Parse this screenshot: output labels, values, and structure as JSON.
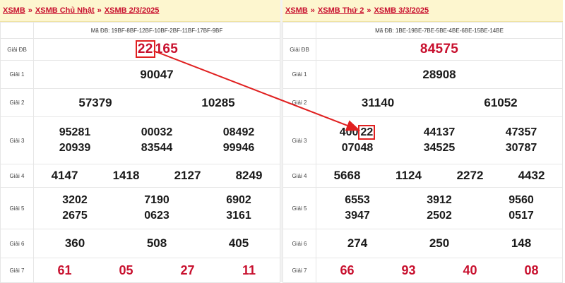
{
  "left": {
    "breadcrumb": [
      "XSMB",
      "XSMB Chủ Nhật",
      "XSMB 2/3/2025"
    ],
    "ma_db": "Mã ĐB: 19BF-8BF-12BF-10BF-2BF-11BF-17BF-9BF",
    "labels": {
      "db": "Giải ĐB",
      "g1": "Giải 1",
      "g2": "Giải 2",
      "g3": "Giải 3",
      "g4": "Giải 4",
      "g5": "Giải 5",
      "g6": "Giải 6",
      "g7": "Giải 7"
    },
    "special_highlight": "22",
    "special_rest": "165",
    "g1": "90047",
    "g2": [
      "57379",
      "10285"
    ],
    "g3": [
      "95281",
      "00032",
      "08492",
      "20939",
      "83544",
      "99946"
    ],
    "g4": [
      "4147",
      "1418",
      "2127",
      "8249"
    ],
    "g5": [
      "3202",
      "7190",
      "6902",
      "2675",
      "0623",
      "3161"
    ],
    "g6": [
      "360",
      "508",
      "405"
    ],
    "g7": [
      "61",
      "05",
      "27",
      "11"
    ]
  },
  "right": {
    "breadcrumb": [
      "XSMB",
      "XSMB Thứ 2",
      "XSMB 3/3/2025"
    ],
    "ma_db": "Mã ĐB: 1BE-19BE-7BE-5BE-4BE-6BE-15BE-14BE",
    "labels": {
      "db": "Giải ĐB",
      "g1": "Giải 1",
      "g2": "Giải 2",
      "g3": "Giải 3",
      "g4": "Giải 4",
      "g5": "Giải 5",
      "g6": "Giải 6",
      "g7": "Giải 7"
    },
    "special": "84575",
    "g1": "28908",
    "g2": [
      "31140",
      "61052"
    ],
    "g3_first_prefix": "400",
    "g3_first_highlight": "22",
    "g3": [
      "44137",
      "47357",
      "07048",
      "34525",
      "30787"
    ],
    "g4": [
      "5668",
      "1124",
      "2272",
      "4432"
    ],
    "g5": [
      "6553",
      "3912",
      "9560",
      "3947",
      "2502",
      "0517"
    ],
    "g6": [
      "274",
      "250",
      "148"
    ],
    "g7": [
      "66",
      "93",
      "40",
      "08"
    ]
  },
  "colors": {
    "accent": "#c8102e",
    "highlight_box": "#e02020",
    "breadcrumb_bg": "#fdf6cf"
  }
}
